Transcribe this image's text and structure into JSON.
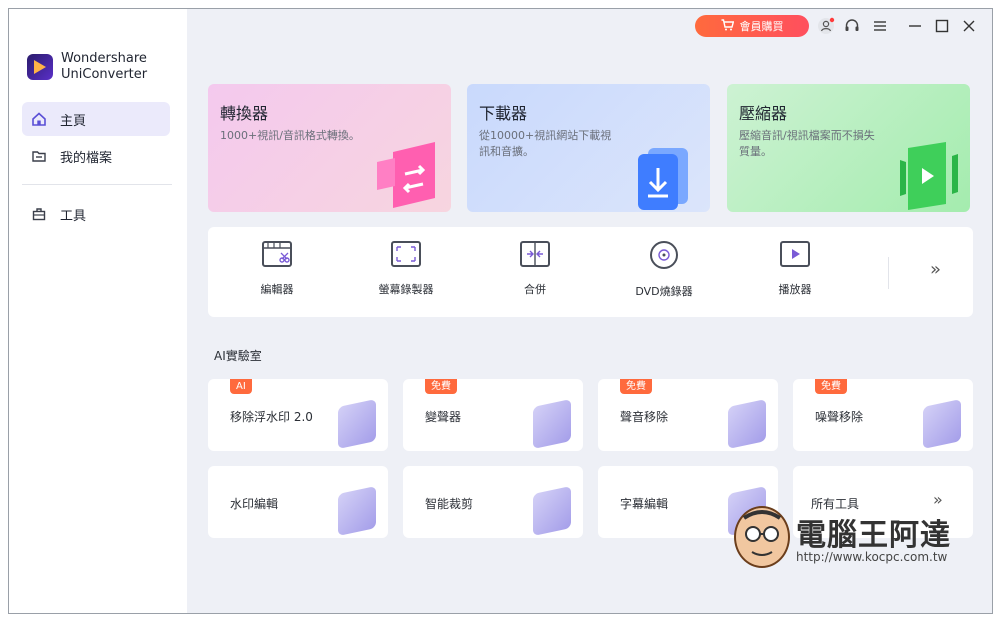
{
  "app": {
    "brand_line1": "Wondershare",
    "brand_line2": "UniConverter"
  },
  "sidebar": {
    "items": [
      {
        "label": "主頁",
        "icon": "home-icon",
        "active": true
      },
      {
        "label": "我的檔案",
        "icon": "folder-icon",
        "active": false
      },
      {
        "label": "工具",
        "icon": "toolbox-icon",
        "active": false
      }
    ]
  },
  "titlebar": {
    "buy_label": "會員購買",
    "icons": [
      "cart-icon",
      "user-icon",
      "headset-icon",
      "menu-icon",
      "minimize-icon",
      "maximize-icon",
      "close-icon"
    ]
  },
  "big_cards": [
    {
      "title": "轉換器",
      "desc": "1000+視訊/音訊格式轉換。",
      "color_from": "#f2c6ef",
      "color_to": "#f6d3dc"
    },
    {
      "title": "下載器",
      "desc": "從10000+視訊網站下載視訊和音擴。",
      "color_from": "#c9d8fb",
      "color_to": "#d8e3fb"
    },
    {
      "title": "壓縮器",
      "desc": "壓縮音訊/視訊檔案而不損失質量。",
      "color_from": "#c8f1cf",
      "color_to": "#a8eeb0"
    }
  ],
  "tools": [
    {
      "label": "編輯器",
      "icon": "scissors-film-icon"
    },
    {
      "label": "螢幕錄製器",
      "icon": "screen-record-icon"
    },
    {
      "label": "合併",
      "icon": "merge-icon"
    },
    {
      "label": "DVD燒錄器",
      "icon": "dvd-icon"
    },
    {
      "label": "播放器",
      "icon": "play-icon"
    }
  ],
  "more_symbol": "»",
  "ai_section": {
    "title": "AI實驗室",
    "cards": [
      {
        "label": "移除浮水印 2.0",
        "badge": "AI"
      },
      {
        "label": "變聲器",
        "badge": "免費"
      },
      {
        "label": "聲音移除",
        "badge": "免費"
      },
      {
        "label": "噪聲移除",
        "badge": "免費"
      },
      {
        "label": "水印編輯",
        "badge": ""
      },
      {
        "label": "智能裁剪",
        "badge": ""
      },
      {
        "label": "字幕編輯",
        "badge": ""
      },
      {
        "label": "所有工具",
        "badge": ""
      }
    ]
  },
  "watermark": {
    "title": "電腦王阿達",
    "url": "http://www.kocpc.com.tw"
  }
}
